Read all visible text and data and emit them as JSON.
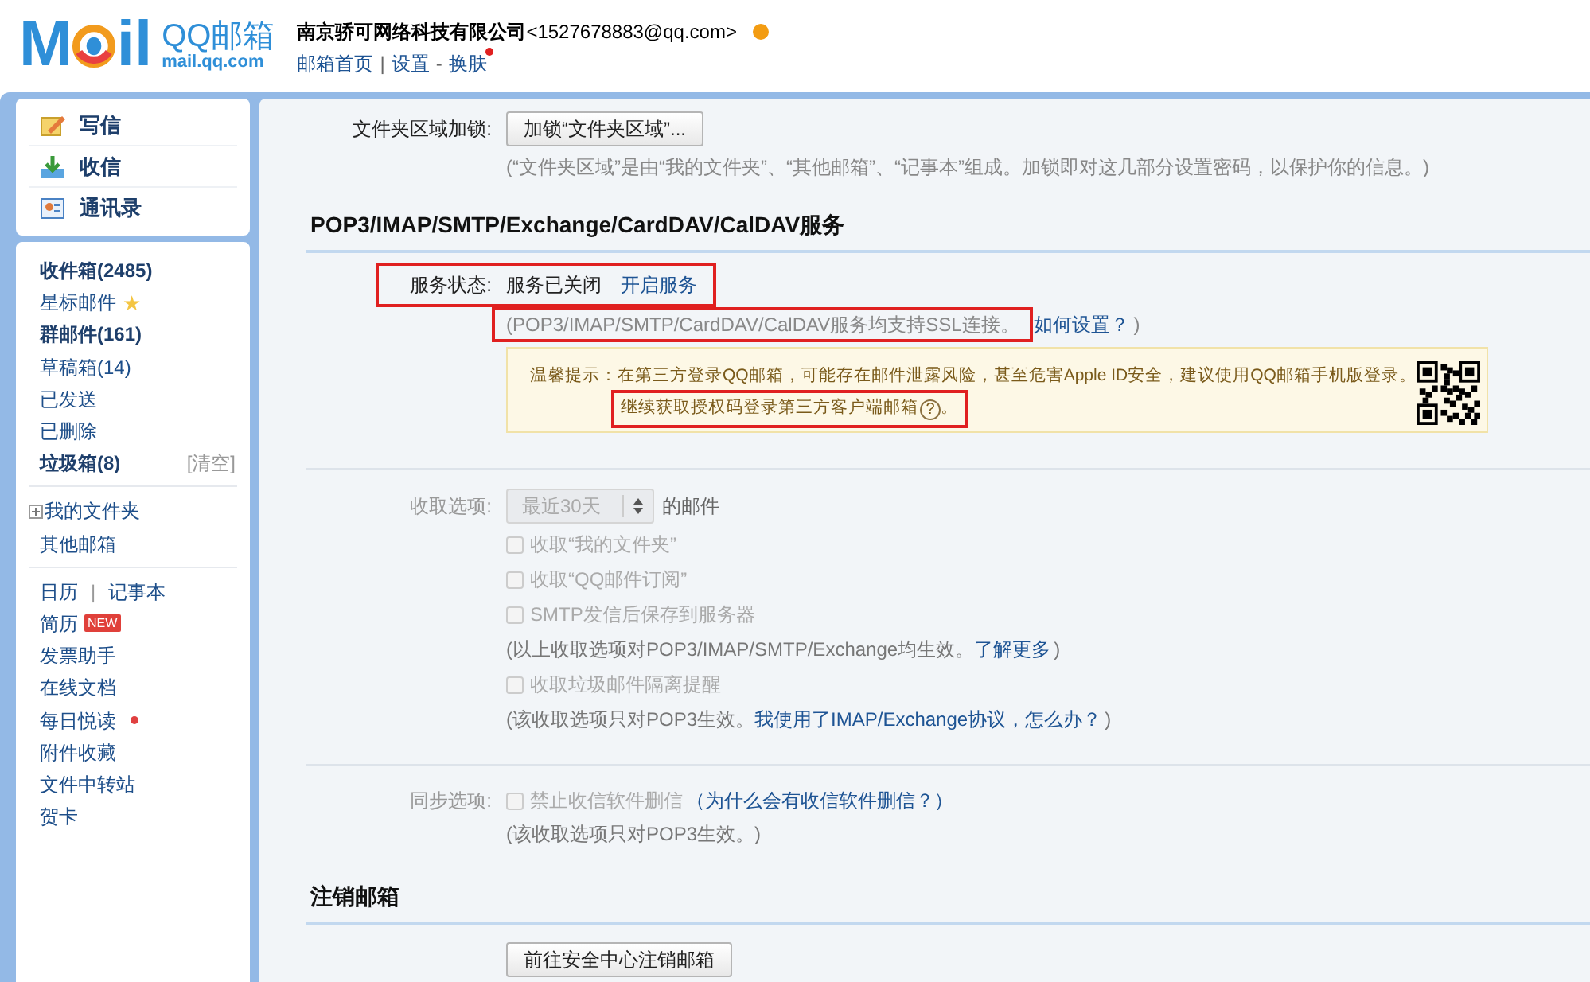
{
  "header": {
    "logo": {
      "letters_before": "M",
      "letters_after": "il",
      "brand": "QQ邮箱",
      "domain": "mail.qq.com"
    },
    "account": {
      "name": "南京骄可网络科技有限公司",
      "email": "<1527678883@qq.com>",
      "alert": true
    },
    "links": [
      {
        "label": "邮箱首页",
        "new_dot": false
      },
      {
        "label": "设置",
        "separator": "|",
        "new_dot": false
      },
      {
        "label": "换肤",
        "separator": "-",
        "new_dot": true
      }
    ]
  },
  "sidebar": {
    "actions": [
      {
        "label": "写信",
        "kind": "compose"
      },
      {
        "label": "收信",
        "kind": "receive"
      },
      {
        "label": "通讯录",
        "kind": "contacts"
      }
    ],
    "groups": [
      [
        {
          "label": "收件箱(2485)",
          "bold": true
        },
        {
          "label": "星标邮件",
          "bold": false,
          "star": "★"
        },
        {
          "label": "群邮件(161)",
          "bold": true
        },
        {
          "label": "草稿箱(14)",
          "bold": false
        },
        {
          "label": "已发送",
          "bold": false
        },
        {
          "label": "已删除",
          "bold": false
        },
        {
          "label": "垃圾箱(8)",
          "bold": true,
          "action": "[清空]"
        }
      ],
      [
        {
          "label": "我的文件夹",
          "bold": false,
          "expandable": true
        },
        {
          "label": "其他邮箱",
          "bold": false
        }
      ],
      [
        {
          "label": "日历",
          "bold": false,
          "separator": "|",
          "second": "记事本"
        },
        {
          "label": "简历",
          "bold": false,
          "badge": "NEW"
        },
        {
          "label": "发票助手",
          "bold": false
        },
        {
          "label": "在线文档",
          "bold": false
        },
        {
          "label": "每日悦读",
          "bold": false,
          "dot": true
        },
        {
          "label": "附件收藏",
          "bold": false
        },
        {
          "label": "文件中转站",
          "bold": false
        },
        {
          "label": "贺卡",
          "bold": false
        }
      ]
    ]
  },
  "folder_lock": {
    "label": "文件夹区域加锁:",
    "button": "加锁“文件夹区域”...",
    "note": "(“文件夹区域”是由“我的文件夹”、“其他邮箱”、“记事本”组成。加锁即对这几部分设置密码，以保护你的信息。)"
  },
  "service": {
    "heading": "POP3/IMAP/SMTP/Exchange/CardDAV/CalDAV服务",
    "status": {
      "label": "服务状态:",
      "value": "服务已关闭",
      "link": "开启服务",
      "highlighted": true
    },
    "ssl_note": {
      "text": "(POP3/IMAP/SMTP/CardDAV/CalDAV服务均支持SSL连接。",
      "highlighted": true,
      "link": "如何设置？",
      "end": ")"
    },
    "warning": {
      "text": "温馨提示：在第三方登录QQ邮箱，可能存在邮件泄露风险，甚至危害Apple ID安全，建议使用QQ邮箱手机版登录。",
      "link": "继续获取授权码登录第三方客户端邮箱",
      "help": "?",
      "end": "。",
      "highlighted": true
    },
    "receive": {
      "label": "收取选项:",
      "select": "最近30天",
      "disabled": true,
      "suffix": "的邮件",
      "options": [
        {
          "kind": "checkbox",
          "label": "收取“我的文件夹”",
          "checked": false,
          "disabled": true
        },
        {
          "kind": "checkbox",
          "label": "收取“QQ邮件订阅”",
          "checked": false,
          "disabled": true
        },
        {
          "kind": "checkbox",
          "label": "SMTP发信后保存到服务器",
          "checked": false,
          "disabled": true
        },
        {
          "kind": "note",
          "text": "(以上收取选项对POP3/IMAP/SMTP/Exchange均生效。",
          "link": "了解更多",
          "end": ")"
        },
        {
          "kind": "checkbox",
          "label": "收取垃圾邮件隔离提醒",
          "checked": false,
          "disabled": true
        },
        {
          "kind": "note",
          "text": "(该收取选项只对POP3生效。",
          "link": "我使用了IMAP/Exchange协议，怎么办？",
          "end": ")"
        }
      ]
    },
    "sync": {
      "label": "同步选项:",
      "checkbox": "禁止收信软件删信",
      "checked": false,
      "disabled": true,
      "link": "（为什么会有收信软件删信？）",
      "note": "(该收取选项只对POP3生效。)"
    }
  },
  "cancel": {
    "heading": "注销邮箱",
    "button": "前往安全中心注销邮箱"
  }
}
